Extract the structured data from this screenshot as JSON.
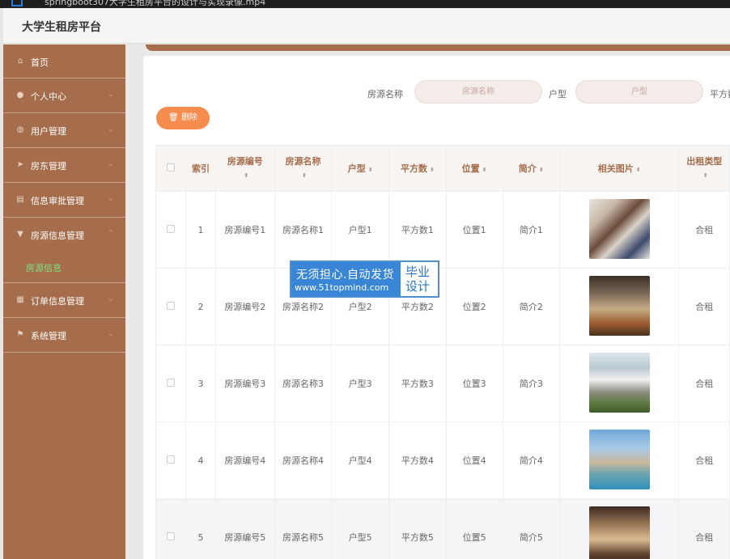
{
  "window": {
    "title": "springboot307大学生租房平台的设计与实现录像.mp4"
  },
  "app": {
    "title": "大学生租房平台"
  },
  "sidebar": {
    "items": [
      {
        "label": "首页",
        "icon": "home-icon"
      },
      {
        "label": "个人中心",
        "icon": "user-icon"
      },
      {
        "label": "用户管理",
        "icon": "users-icon"
      },
      {
        "label": "房东管理",
        "icon": "send-icon"
      },
      {
        "label": "信息审批管理",
        "icon": "clipboard-icon"
      },
      {
        "label": "房源信息管理",
        "icon": "funnel-icon"
      },
      {
        "label": "订单信息管理",
        "icon": "document-icon"
      },
      {
        "label": "系统管理",
        "icon": "flag-icon"
      }
    ],
    "active_sub": "房源信息"
  },
  "search": {
    "fields": [
      {
        "label": "房源名称",
        "placeholder": "房源名称"
      },
      {
        "label": "户型",
        "placeholder": "户型"
      },
      {
        "label": "平方数"
      }
    ]
  },
  "toolbar": {
    "delete_label": "删除"
  },
  "table": {
    "columns": [
      "索引",
      "房源编号",
      "房源名称",
      "户型",
      "平方数",
      "位置",
      "简介",
      "相关图片",
      "出租类型"
    ],
    "rows": [
      {
        "index": "1",
        "code": "房源编号1",
        "name": "房源名称1",
        "type": "户型1",
        "area": "平方数1",
        "location": "位置1",
        "intro": "简介1",
        "rent": "合租"
      },
      {
        "index": "2",
        "code": "房源编号2",
        "name": "房源名称2",
        "type": "户型2",
        "area": "平方数2",
        "location": "位置2",
        "intro": "简介2",
        "rent": "合租"
      },
      {
        "index": "3",
        "code": "房源编号3",
        "name": "房源名称3",
        "type": "户型3",
        "area": "平方数3",
        "location": "位置3",
        "intro": "简介3",
        "rent": "合租"
      },
      {
        "index": "4",
        "code": "房源编号4",
        "name": "房源名称4",
        "type": "户型4",
        "area": "平方数4",
        "location": "位置4",
        "intro": "简介4",
        "rent": "合租"
      },
      {
        "index": "5",
        "code": "房源编号5",
        "name": "房源名称5",
        "type": "户型5",
        "area": "平方数5",
        "location": "位置5",
        "intro": "简介5",
        "rent": "合租"
      }
    ]
  },
  "watermark": {
    "line1": "无须担心.自动发货",
    "line2": "www.51topmind.com",
    "badge1": "毕业",
    "badge2": "设计"
  },
  "colors": {
    "sidebar": "#a56d4b",
    "accent_button": "#f68c4e",
    "active_sub": "#7fe07f",
    "header_text": "#a56d4b"
  }
}
